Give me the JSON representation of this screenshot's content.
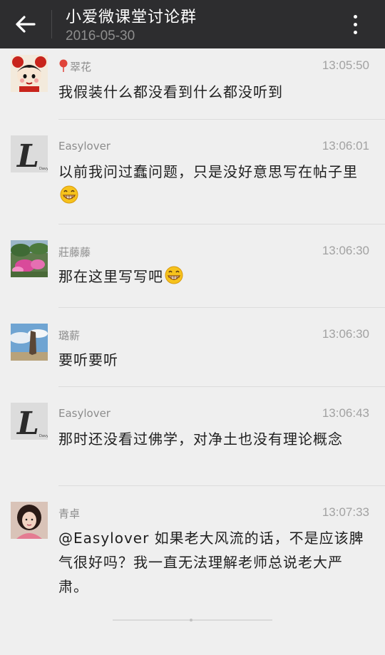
{
  "header": {
    "title": "小爱微课堂讨论群",
    "date": "2016-05-30"
  },
  "messages": [
    {
      "sender": "翠花",
      "time": "13:05:50",
      "text": "我假装什么都没看到什么都没听到",
      "avatar": "cartoon-girl-avatar"
    },
    {
      "sender": "Easylover",
      "time": "13:06:01",
      "text": "以前我问过蠢问题，只是没好意思写在帖子里",
      "emoji": "grin-emoji",
      "avatar": "gothic-L-avatar"
    },
    {
      "sender": "莊藤藤",
      "time": "13:06:30",
      "text": "那在这里写写吧",
      "emoji": "grin-emoji",
      "avatar": "flower-garden-avatar"
    },
    {
      "sender": "璐薪",
      "time": "13:06:30",
      "text": "要听要听",
      "avatar": "rock-sky-avatar"
    },
    {
      "sender": "Easylover",
      "time": "13:06:43",
      "text": "那时还没看过佛学，对净土也没有理论概念",
      "avatar": "gothic-L-avatar"
    },
    {
      "sender": "青卓",
      "time": "13:07:33",
      "text": "@Easylover 如果老大风流的话，不是应该脾气很好吗？我一直无法理解老师总说老大严肃。",
      "avatar": "woman-photo-avatar"
    }
  ],
  "colors": {
    "topbar": "#2d2d2f",
    "background": "#efefef",
    "pin": "#e0443a",
    "emoji": "#f6c21c"
  }
}
